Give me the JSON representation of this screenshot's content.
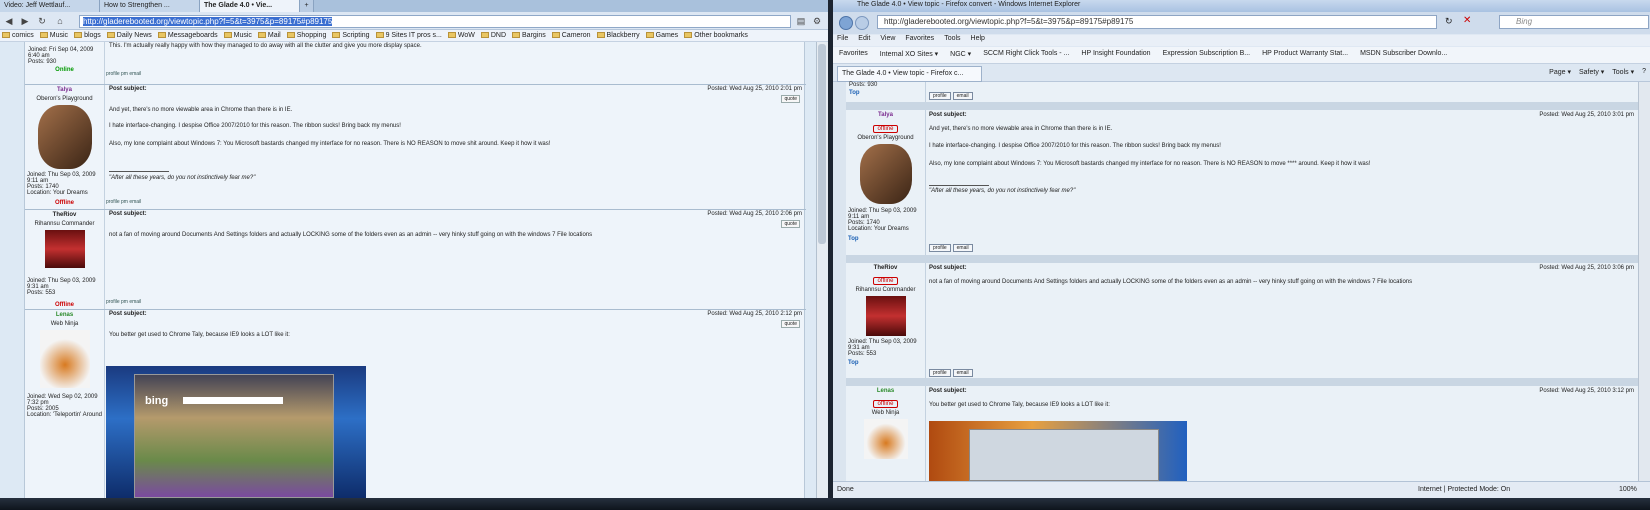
{
  "chrome": {
    "tabs": [
      "Video: Jeff Wettlauf...",
      "How to Strengthen ...",
      "The Glade 4.0 • Vie...",
      "+"
    ],
    "url": "http://gladerebooted.org/viewtopic.php?f=5&t=3975&p=89175#p89175",
    "bookmarks": [
      "comics",
      "Music",
      "blogs",
      "Daily News",
      "Messageboards",
      "Music",
      "Mail",
      "Shopping",
      "Scripting",
      "9 Sites IT pros s...",
      "WoW",
      "DND",
      "Bargins",
      "Cameron",
      "Blackberry",
      "Games",
      "Other bookmarks"
    ],
    "prev_text": "This. I'm actually really happy with how they managed to do away with all the clutter and give you more display space.",
    "prev_joined": "Joined: Fri Sep 04, 2009",
    "prev_time": "6:40 am",
    "prev_posts": "Posts: 930",
    "prev_status": "Online",
    "post_bar": "profile  pm  email",
    "subject_label": "Post subject:",
    "edit_label": "quote",
    "posts": [
      {
        "name": "Talya",
        "rank": "Oberon's Playground",
        "posted": "Posted: Wed Aug 25, 2010 2:01 pm",
        "lines": [
          "And yet, there's no more viewable area in Chrome than there is in IE.",
          "I hate interface-changing. I despise Office 2007/2010 for this reason. The ribbon sucks! Bring back my menus!",
          "Also, my lone complaint about Windows 7: You Microsoft bastards changed my interface for no reason. There is NO REASON to move shit around. Keep it how it was!"
        ],
        "sig": "\"After all these years, do you not instinctively fear me?\"",
        "joined": "Joined: Thu Sep 03, 2009",
        "time": "9:11 am",
        "posts": "Posts: 1740",
        "loc": "Location: Your Dreams",
        "status": "Offline"
      },
      {
        "name": "TheRiov",
        "rank": "Rihannsu Commander",
        "posted": "Posted: Wed Aug 25, 2010 2:06 pm",
        "lines": [
          "not a fan of moving around Documents And Settings folders and actually LOCKING some of the folders even as an admin -- very hinky stuff going on with the windows 7 File locations"
        ],
        "joined": "Joined: Thu Sep 03, 2009",
        "time": "9:31 am",
        "posts": "Posts: 553",
        "status": "Offline"
      },
      {
        "name": "Lenas",
        "rank": "Web Ninja",
        "posted": "Posted: Wed Aug 25, 2010 2:12 pm",
        "lines": [
          "You better get used to Chrome Taly, because IE9 looks a LOT like it:"
        ],
        "joined": "Joined: Wed Sep 02, 2009",
        "time": "7:32 pm",
        "posts": "Posts: 2005",
        "loc": "Location: 'Teleportin' Around"
      }
    ],
    "bing_text": "bing"
  },
  "ie": {
    "title": "The Glade 4.0 • View topic - Firefox convert - Windows Internet Explorer",
    "url": "http://gladerebooted.org/viewtopic.php?f=5&t=3975&p=89175#p89175",
    "search": "Bing",
    "menu": [
      "File",
      "Edit",
      "View",
      "Favorites",
      "Tools",
      "Help"
    ],
    "favorites": [
      "Favorites",
      "Internal XO Sites ▾",
      "NGC ▾",
      "SCCM Right Click Tools - ...",
      "HP Insight Foundation",
      "Expression Subscription B...",
      "HP Product Warranty Stat...",
      "MSDN Subscriber Downlo..."
    ],
    "tab": "The Glade 4.0 • View topic - Firefox c...",
    "tools": [
      "Page ▾",
      "Safety ▾",
      "Tools ▾",
      "?"
    ],
    "top": "Top",
    "profile": "profile",
    "email": "email",
    "offline": "offline",
    "prev_posts": "Posts: 930",
    "posts": [
      {
        "name": "Talya",
        "rank": "Oberon's Playground",
        "posted": "Posted: Wed Aug 25, 2010 3:01 pm",
        "lines": [
          "And yet, there's no more viewable area in Chrome than there is in IE.",
          "I hate interface-changing. I despise Office 2007/2010 for this reason. The ribbon sucks! Bring back my menus!",
          "Also, my lone complaint about Windows 7: You Microsoft bastards changed my interface for no reason. There is NO REASON to move **** around. Keep it how it was!"
        ],
        "sig": "\"After all these years, do you not instinctively fear me?\"",
        "joined": "Joined: Thu Sep 03, 2009",
        "time": "9:11 am",
        "posts": "Posts: 1740",
        "loc": "Location: Your Dreams"
      },
      {
        "name": "TheRiov",
        "rank": "Rihannsu Commander",
        "posted": "Posted: Wed Aug 25, 2010 3:06 pm",
        "lines": [
          "not a fan of moving around Documents And Settings folders and actually LOCKING some of the folders even as an admin -- very hinky stuff going on with the windows 7 File locations"
        ],
        "joined": "Joined: Thu Sep 03, 2009",
        "time": "9:31 am",
        "posts": "Posts: 553"
      },
      {
        "name": "Lenas",
        "rank": "Web Ninja",
        "posted": "Posted: Wed Aug 25, 2010 3:12 pm",
        "lines": [
          "You better get used to Chrome Taly, because IE9 looks a LOT like it:"
        ]
      }
    ],
    "status_left": "Done",
    "status_zone": "Internet | Protected Mode: On",
    "zoom": "100%"
  }
}
